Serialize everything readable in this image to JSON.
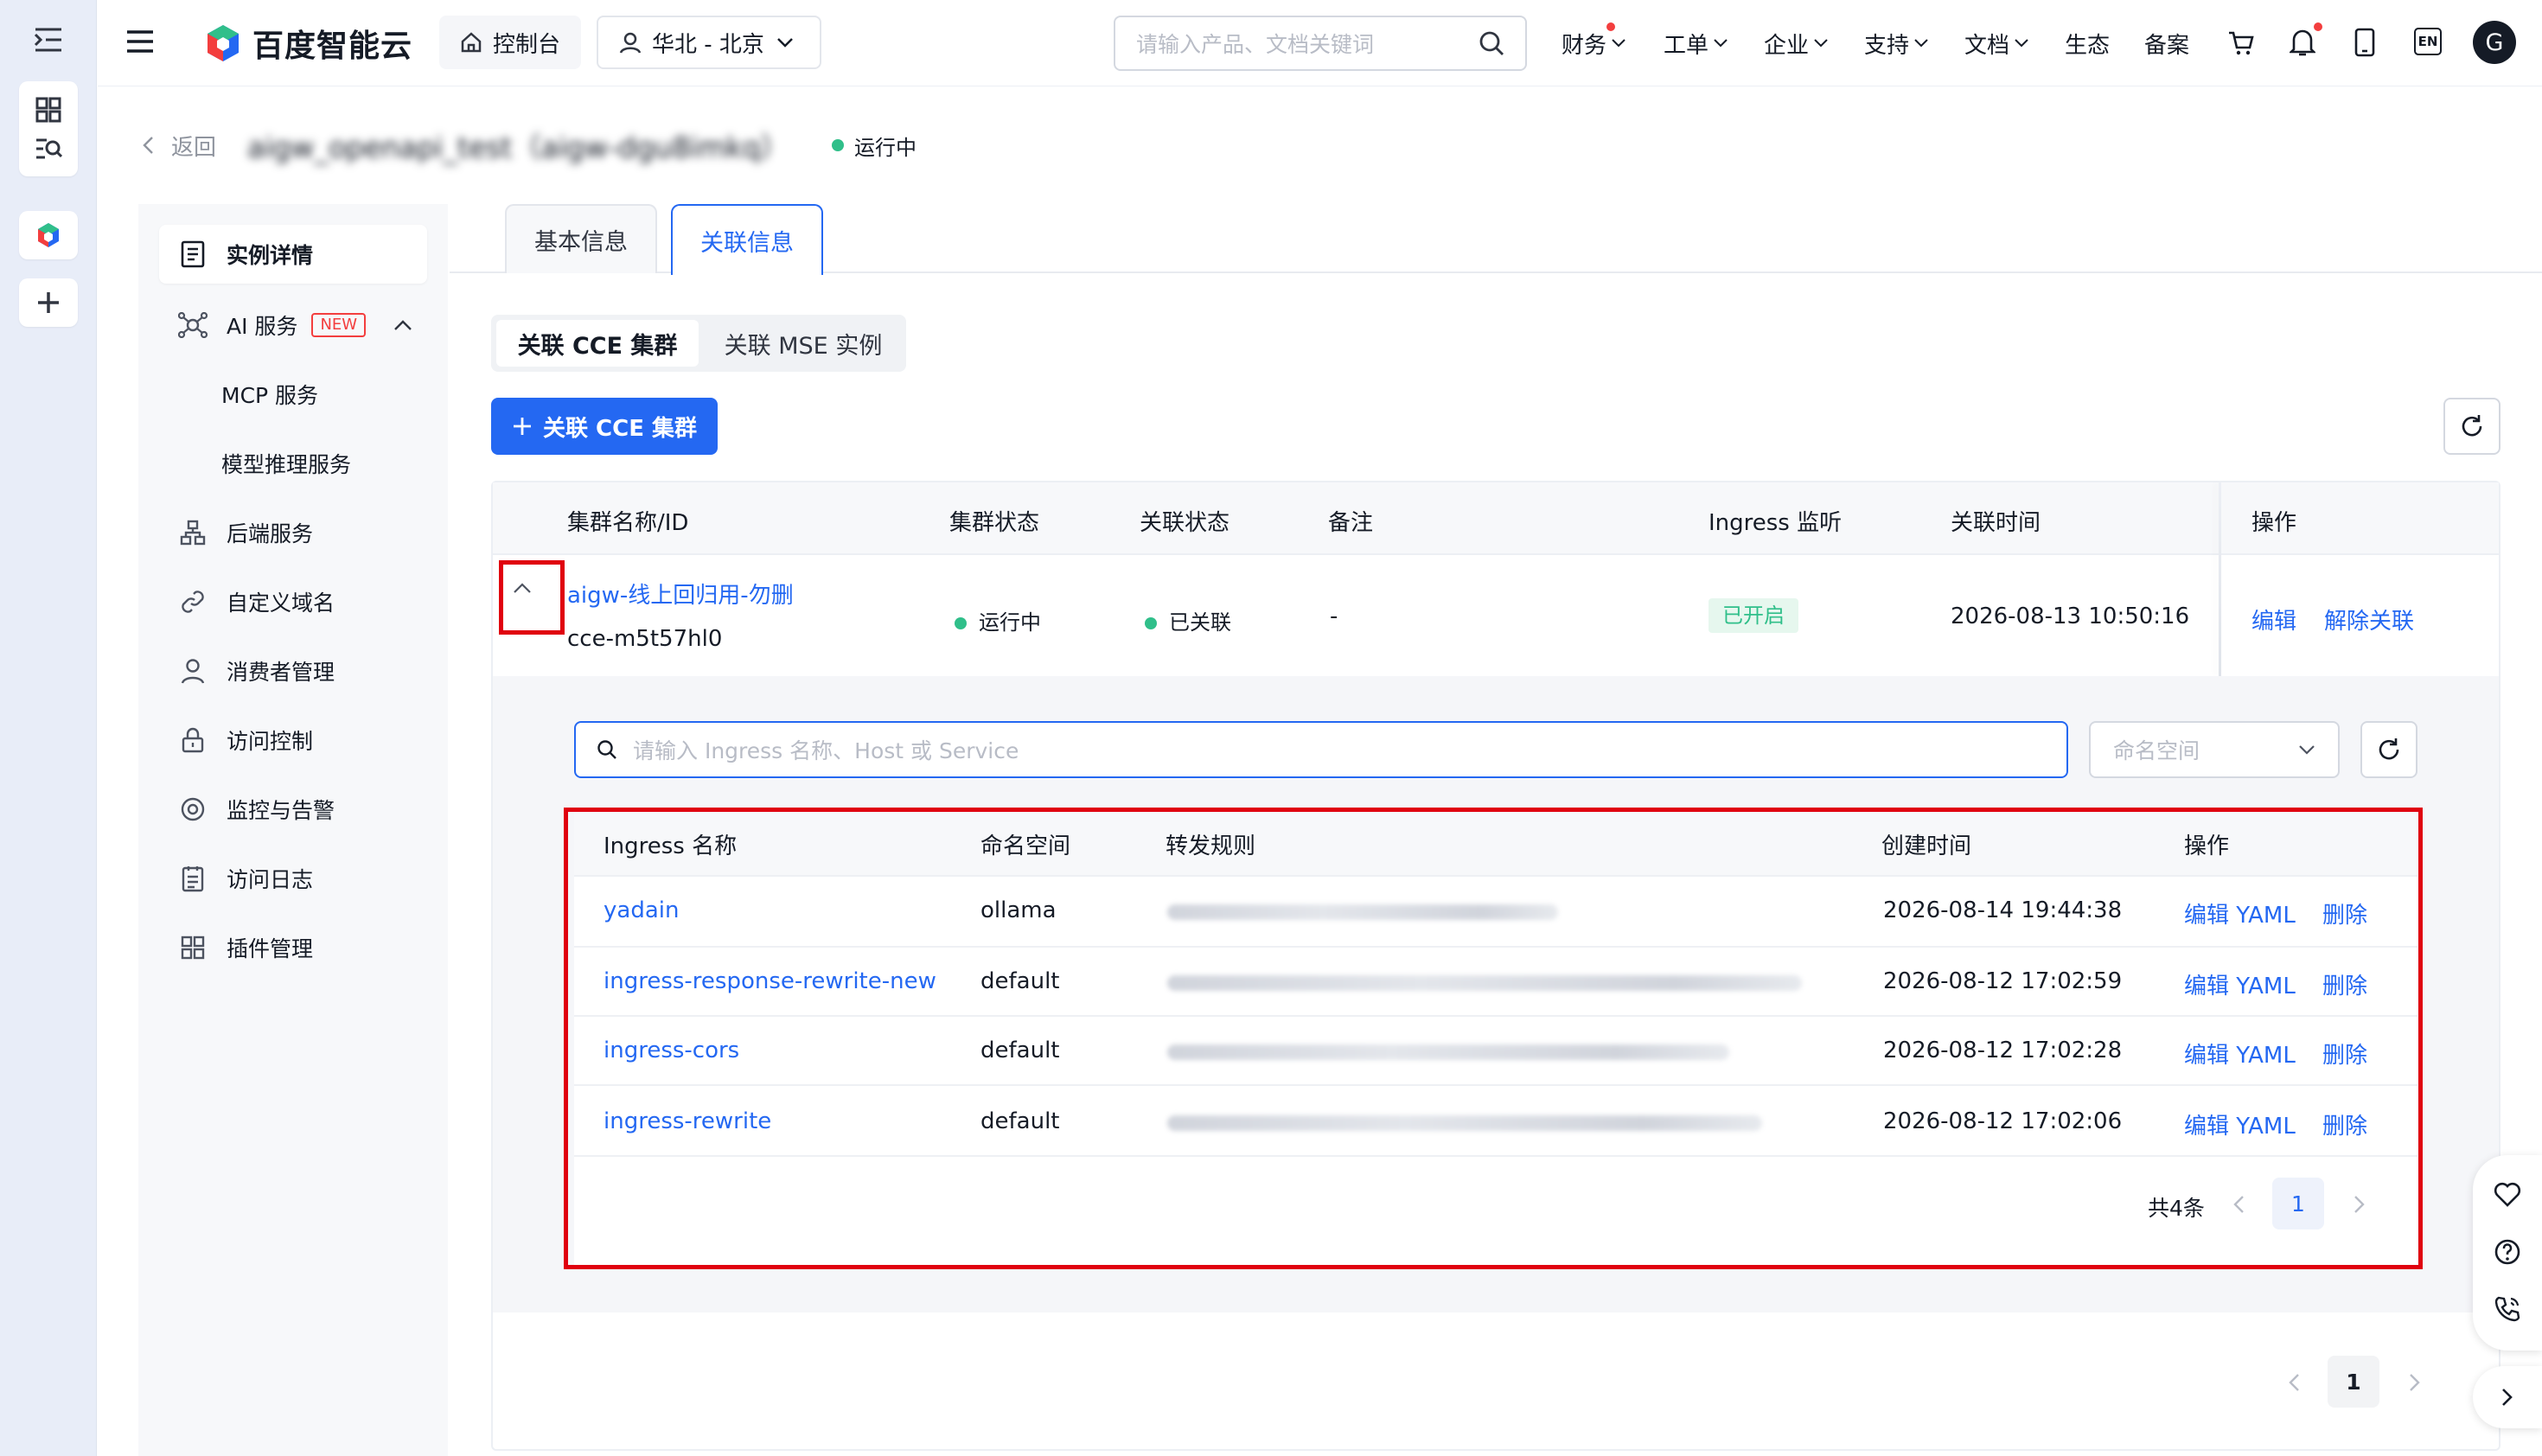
{
  "topbar": {
    "brand": "百度智能云",
    "console": "控制台",
    "region": "华北 - 北京",
    "search_placeholder": "请输入产品、文档关键词",
    "menus": [
      "财务",
      "工单",
      "企业",
      "支持",
      "文档",
      "生态",
      "备案"
    ],
    "lang": "EN",
    "avatar": "G"
  },
  "header": {
    "back": "返回",
    "instance_title": "aigw_openapi_test（aigw-dgu8imkq）",
    "status": "运行中"
  },
  "sidebar": {
    "items": [
      {
        "label": "实例详情",
        "icon": "document-icon"
      },
      {
        "label": "AI 服务",
        "icon": "ai-network-icon",
        "badge": "NEW"
      },
      {
        "label": "MCP 服务"
      },
      {
        "label": "模型推理服务"
      },
      {
        "label": "后端服务",
        "icon": "hierarchy-icon"
      },
      {
        "label": "自定义域名",
        "icon": "link-icon"
      },
      {
        "label": "消费者管理",
        "icon": "user-icon"
      },
      {
        "label": "访问控制",
        "icon": "lock-icon"
      },
      {
        "label": "监控与告警",
        "icon": "monitor-icon"
      },
      {
        "label": "访问日志",
        "icon": "log-icon"
      },
      {
        "label": "插件管理",
        "icon": "grid-icon"
      }
    ]
  },
  "tabs": {
    "basic": "基本信息",
    "related": "关联信息"
  },
  "segment": {
    "cce": "关联 CCE 集群",
    "mse": "关联 MSE 实例"
  },
  "add_button": "关联 CCE 集群",
  "cluster_table": {
    "headers": [
      "集群名称/ID",
      "集群状态",
      "关联状态",
      "备注",
      "Ingress 监听",
      "关联时间",
      "操作"
    ],
    "row": {
      "name": "aigw-线上回归用-勿删",
      "id": "cce-m5t57hl0",
      "cluster_status": "运行中",
      "relation_status": "已关联",
      "remark": "-",
      "ingress": "已开启",
      "time": "2026-08-13 10:50:16",
      "action_edit": "编辑",
      "action_unlink": "解除关联"
    }
  },
  "ingress": {
    "search_placeholder": "请输入 Ingress 名称、Host 或 Service",
    "namespace_placeholder": "命名空间",
    "headers": [
      "Ingress 名称",
      "命名空间",
      "转发规则",
      "创建时间",
      "操作"
    ],
    "rows": [
      {
        "name": "yadain",
        "ns": "ollama",
        "time": "2026-08-14 19:44:38"
      },
      {
        "name": "ingress-response-rewrite-new",
        "ns": "default",
        "time": "2026-08-12 17:02:59"
      },
      {
        "name": "ingress-cors",
        "ns": "default",
        "time": "2026-08-12 17:02:28"
      },
      {
        "name": "ingress-rewrite",
        "ns": "default",
        "time": "2026-08-12 17:02:06"
      }
    ],
    "edit_label": "编辑 YAML",
    "delete_label": "删除",
    "total": "共4条",
    "page": "1"
  },
  "outer_page": "1"
}
